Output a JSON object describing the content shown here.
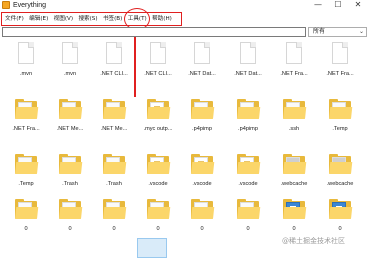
{
  "window": {
    "title": "Everything",
    "minimize": "—",
    "maximize": "☐",
    "close": "✕"
  },
  "menu": [
    {
      "label": "文件(F)",
      "name": "menu-file"
    },
    {
      "label": "编辑(E)",
      "name": "menu-edit"
    },
    {
      "label": "视图(V)",
      "name": "menu-view"
    },
    {
      "label": "搜索(S)",
      "name": "menu-search"
    },
    {
      "label": "书签(B)",
      "name": "menu-bookmarks"
    },
    {
      "label": "工具(T)",
      "name": "menu-tools"
    },
    {
      "label": "帮助(H)",
      "name": "menu-help"
    }
  ],
  "search": {
    "value": "",
    "placeholder": ""
  },
  "filter": {
    "selected": "所有"
  },
  "annotation": {
    "color": "#e02020",
    "highlight": "menu-tools"
  },
  "files": [
    {
      "label": ".mvn",
      "kind": "doc"
    },
    {
      "label": ".mvn",
      "kind": "doc"
    },
    {
      "label": ".NET CLI...",
      "kind": "doc"
    },
    {
      "label": ".NET CLI...",
      "kind": "doc"
    },
    {
      "label": ".NET Dat...",
      "kind": "doc"
    },
    {
      "label": ".NET Dat...",
      "kind": "doc"
    },
    {
      "label": ".NET Fra...",
      "kind": "doc"
    },
    {
      "label": ".NET Fra...",
      "kind": "doc"
    },
    {
      "label": ".NET Fra...",
      "kind": "folder"
    },
    {
      "label": ".NET Me...",
      "kind": "folder"
    },
    {
      "label": ".NET Me...",
      "kind": "folder"
    },
    {
      "label": ".myc outp...",
      "kind": "folder-pdf"
    },
    {
      "label": ".p4pimp",
      "kind": "folder"
    },
    {
      "label": ".p4pimp",
      "kind": "folder"
    },
    {
      "label": ".ssh",
      "kind": "folder"
    },
    {
      "label": ".Temp",
      "kind": "folder"
    },
    {
      "label": ".Temp",
      "kind": "folder"
    },
    {
      "label": ".Trash",
      "kind": "folder"
    },
    {
      "label": ".Trash",
      "kind": "folder"
    },
    {
      "label": ".vscode",
      "kind": "folder-pdf"
    },
    {
      "label": ".vscode",
      "kind": "folder-pdf"
    },
    {
      "label": ".vscode",
      "kind": "folder-pdf"
    },
    {
      "label": ".webcache",
      "kind": "folder-grey"
    },
    {
      "label": ".webcache",
      "kind": "folder-grey"
    },
    {
      "label": "0",
      "kind": "folder"
    },
    {
      "label": "0",
      "kind": "folder"
    },
    {
      "label": "0",
      "kind": "folder"
    },
    {
      "label": "0",
      "kind": "folder"
    },
    {
      "label": "0",
      "kind": "folder"
    },
    {
      "label": "0",
      "kind": "folder"
    },
    {
      "label": "0",
      "kind": "folder-bluedoc"
    },
    {
      "label": "0",
      "kind": "folder-bluedoc"
    }
  ],
  "watermark": "@稀土掘金技术社区"
}
